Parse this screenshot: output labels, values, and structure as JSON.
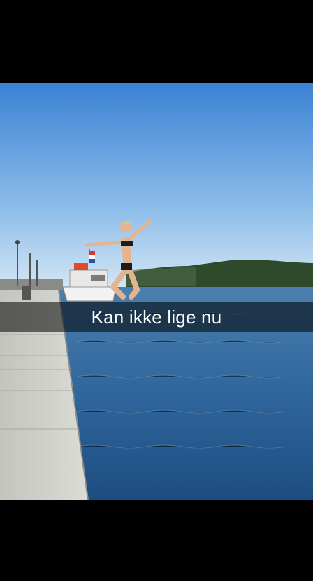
{
  "snap": {
    "caption": "Kan ikke lige nu",
    "colors": {
      "sky_top": "#3f86d6",
      "sky_bottom": "#cfe3f5",
      "sea": "#3a6e9f",
      "sea_dark": "#1f4b77",
      "hill": "#2f4a2c",
      "pier": "#cfcfc9",
      "caption_bg": "rgba(0,0,0,0.55)"
    },
    "scene_icons": [
      "boat-icon",
      "diver-figure",
      "hill-silhouette",
      "pier-surface"
    ]
  }
}
